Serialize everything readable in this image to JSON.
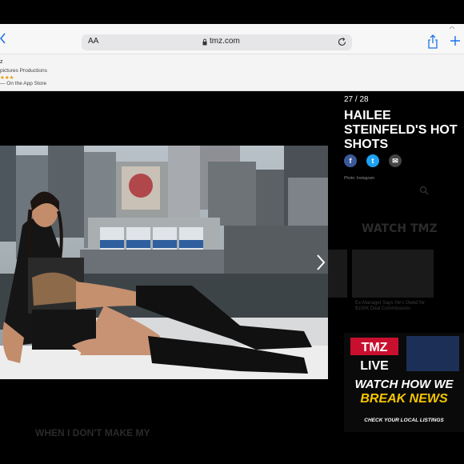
{
  "browser": {
    "reader_label": "AA",
    "url": "tmz.com"
  },
  "app_banner": {
    "line1": "z",
    "line2": "pictures Productions",
    "rating": "★★★",
    "line4": "— On the App Store"
  },
  "gallery": {
    "counter": "27 / 28",
    "title": "HAILEE STEINFELD'S HOT SHOTS",
    "photo_credit": "Photo: Instagram",
    "watch_heading": "WATCH TMZ",
    "caption": "Ex-Manager Says He's Owed for $100K Deal Commissions",
    "bottom_text": "WHEN I DON'T MAKE MY"
  },
  "share": {
    "facebook": "f",
    "twitter": "t",
    "email": "✉"
  },
  "ad": {
    "brand": "TMZ",
    "live": "LIVE",
    "line1": "WATCH HOW WE",
    "line2": "BREAK NEWS",
    "listings": "CHECK YOUR LOCAL LISTINGS"
  },
  "colors": {
    "facebook": "#3b5998",
    "twitter": "#1da1f2",
    "email": "#444444",
    "ad_yellow": "#f7c600",
    "tmz_red": "#c8102e"
  }
}
